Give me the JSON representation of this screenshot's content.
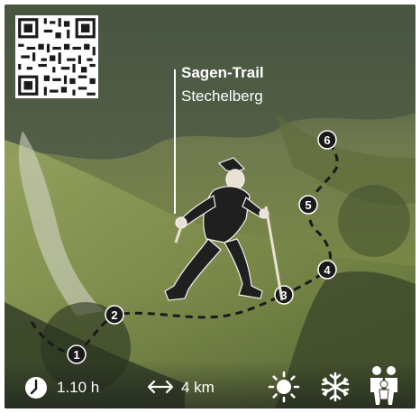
{
  "trail": {
    "title": "Sagen-Trail",
    "subtitle": "Stechelberg"
  },
  "stats": {
    "duration": "1.10 h",
    "distance": "4 km"
  },
  "icons": {
    "clock": "clock-icon",
    "distance": "double-arrow-icon",
    "sun": "sun-icon",
    "snowflake": "snowflake-icon",
    "family": "family-icon",
    "qr": "qr-code-icon"
  },
  "waypoints": [
    "1",
    "2",
    "3",
    "4",
    "5",
    "6"
  ],
  "colors": {
    "text": "#ffffff",
    "route": "#1a1a1a"
  }
}
